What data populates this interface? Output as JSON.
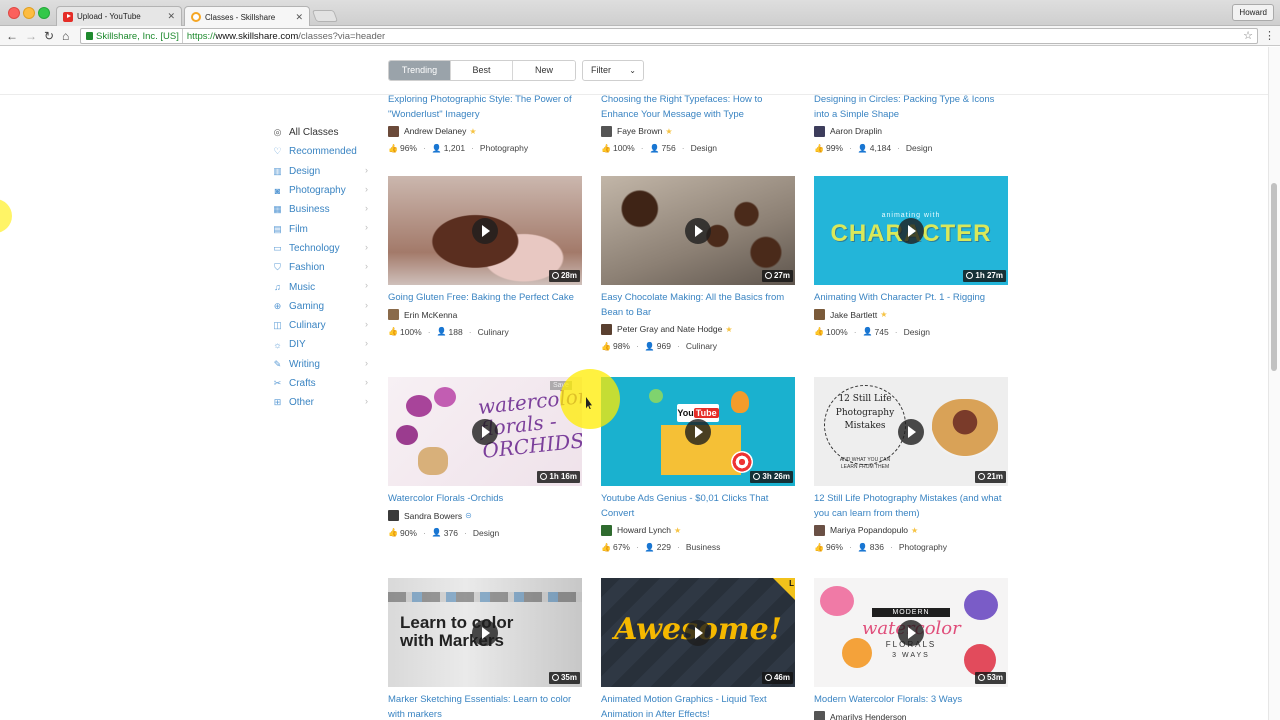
{
  "browser": {
    "tabs": [
      {
        "title": "Upload - YouTube",
        "favicon": "youtube-favicon",
        "active": false
      },
      {
        "title": "Classes - Skillshare",
        "favicon": "skillshare-favicon",
        "active": true
      }
    ],
    "profile": "Howard",
    "ev_cert": "Skillshare, Inc. [US]",
    "url_scheme": "https://",
    "url_host": "www.skillshare.com",
    "url_path": "/classes?via=header",
    "close_glyph": "✕"
  },
  "filters": {
    "segments": [
      "Trending",
      "Best",
      "New"
    ],
    "active": "Trending",
    "dropdown_label": "Filter"
  },
  "sidebar": {
    "items": [
      {
        "label": "All Classes",
        "icon": "compass-icon",
        "glyph": "◎"
      },
      {
        "label": "Recommended",
        "icon": "heart-icon",
        "glyph": "♡"
      },
      {
        "label": "Design",
        "icon": "pencil-ruler-icon",
        "glyph": "▥"
      },
      {
        "label": "Photography",
        "icon": "camera-icon",
        "glyph": "◙"
      },
      {
        "label": "Business",
        "icon": "bar-chart-icon",
        "glyph": "▦"
      },
      {
        "label": "Film",
        "icon": "film-icon",
        "glyph": "▤"
      },
      {
        "label": "Technology",
        "icon": "laptop-icon",
        "glyph": "▭"
      },
      {
        "label": "Fashion",
        "icon": "shirt-icon",
        "glyph": "⛉"
      },
      {
        "label": "Music",
        "icon": "music-note-icon",
        "glyph": "♫"
      },
      {
        "label": "Gaming",
        "icon": "gamepad-icon",
        "glyph": "⊕"
      },
      {
        "label": "Culinary",
        "icon": "cup-icon",
        "glyph": "◫"
      },
      {
        "label": "DIY",
        "icon": "lightbulb-icon",
        "glyph": "☼"
      },
      {
        "label": "Writing",
        "icon": "pen-icon",
        "glyph": "✎"
      },
      {
        "label": "Crafts",
        "icon": "scissors-icon",
        "glyph": "✂"
      },
      {
        "label": "Other",
        "icon": "globe-icon",
        "glyph": "⊞"
      }
    ],
    "chevron": "›"
  },
  "icons": {
    "thumbs_up": "👍",
    "student": "👤",
    "star": "★",
    "check": "⊝",
    "separator": "·"
  },
  "classes": [
    {
      "title": "Exploring Photographic Style: The Power of \"Wonderlust\" Imagery",
      "teacher": "Andrew Delaney",
      "badge": "star",
      "rating": "96%",
      "students": "1,201",
      "category": "Photography"
    },
    {
      "title": "Choosing the Right Typefaces: How to Enhance Your Message with Type",
      "teacher": "Faye Brown",
      "badge": "star",
      "rating": "100%",
      "students": "756",
      "category": "Design"
    },
    {
      "title": "Designing in Circles: Packing Type & Icons into a Simple Shape",
      "teacher": "Aaron Draplin",
      "badge": "",
      "rating": "99%",
      "students": "4,184",
      "category": "Design"
    },
    {
      "title": "Going Gluten Free: Baking the Perfect Cake",
      "teacher": "Erin McKenna",
      "badge": "",
      "rating": "100%",
      "students": "188",
      "category": "Culinary",
      "duration": "28m"
    },
    {
      "title": "Easy Chocolate Making: All the Basics from Bean to Bar",
      "teacher": "Peter Gray and Nate Hodge",
      "badge": "star",
      "rating": "98%",
      "students": "969",
      "category": "Culinary",
      "duration": "27m"
    },
    {
      "title": "Animating With Character Pt. 1 - Rigging",
      "teacher": "Jake Bartlett",
      "badge": "star",
      "rating": "100%",
      "students": "745",
      "category": "Design",
      "duration": "1h 27m",
      "thumb_text_small": "animating with",
      "thumb_text_big": "CHARACTER"
    },
    {
      "title": "Watercolor Florals -Orchids",
      "teacher": "Sandra Bowers",
      "badge": "check",
      "rating": "90%",
      "students": "376",
      "category": "Design",
      "duration": "1h 16m",
      "save_label": "Save",
      "thumb_text": "watercolor florals -ORCHIDS"
    },
    {
      "title": "Youtube Ads Genius - $0,01 Clicks That Convert",
      "teacher": "Howard Lynch",
      "badge": "star",
      "rating": "67%",
      "students": "229",
      "category": "Business",
      "duration": "3h 26m",
      "thumb_logo_a": "You",
      "thumb_logo_b": "Tube"
    },
    {
      "title": "12 Still Life Photography Mistakes (and what you can learn from them)",
      "teacher": "Mariya Popandopulo",
      "badge": "star",
      "rating": "96%",
      "students": "836",
      "category": "Photography",
      "duration": "21m",
      "thumb_text": "12 Still Life Photography Mistakes",
      "thumb_sub": "AND WHAT YOU CAN LEARN FROM THEM"
    },
    {
      "title": "Marker Sketching Essentials: Learn to color with markers",
      "teacher": "",
      "badge": "",
      "rating": "",
      "students": "",
      "category": "",
      "duration": "35m",
      "thumb_text": "Learn to color with Markers"
    },
    {
      "title": "Animated Motion Graphics - Liquid Text Animation in After Effects!",
      "teacher": "",
      "badge": "",
      "rating": "",
      "students": "",
      "category": "",
      "duration": "46m",
      "thumb_text": "Awesome!",
      "corner_label": "L"
    },
    {
      "title": "Modern Watercolor Florals: 3 Ways",
      "teacher": "Amarilys Henderson",
      "badge": "",
      "rating": "",
      "students": "",
      "category": "",
      "duration": "53m",
      "thumb_band": "MODERN",
      "thumb_script": "watercolor",
      "thumb_text": "FLORALS",
      "thumb_sub": "3 WAYS"
    }
  ],
  "colors": {
    "link": "#3a84c2",
    "active_segment": "#9aa3aa",
    "star": "#f6c343"
  }
}
